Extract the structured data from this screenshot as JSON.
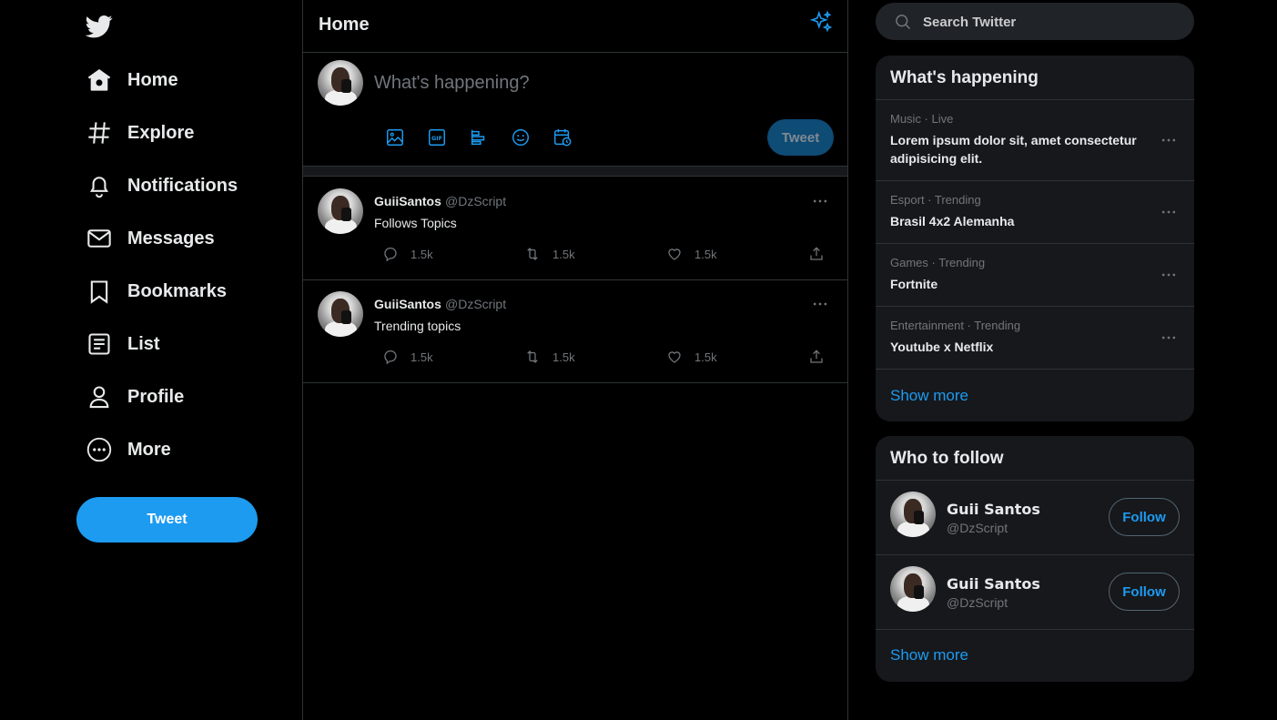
{
  "colors": {
    "accent": "#1d9bf0",
    "background": "#000000",
    "panel": "#16181c",
    "muted": "#71767b"
  },
  "nav": {
    "items": [
      {
        "icon": "home-icon",
        "label": "Home"
      },
      {
        "icon": "hashtag-icon",
        "label": "Explore"
      },
      {
        "icon": "bell-icon",
        "label": "Notifications"
      },
      {
        "icon": "mail-icon",
        "label": "Messages"
      },
      {
        "icon": "bookmark-icon",
        "label": "Bookmarks"
      },
      {
        "icon": "list-icon",
        "label": "List"
      },
      {
        "icon": "person-icon",
        "label": "Profile"
      },
      {
        "icon": "more-circle-icon",
        "label": "More"
      }
    ],
    "tweet_button": "Tweet"
  },
  "main": {
    "title": "Home",
    "composer": {
      "placeholder": "What's happening?",
      "tweet_button": "Tweet"
    },
    "tweets": [
      {
        "name": "GuiiSantos",
        "handle": "@DzScript",
        "text": "Follows Topics",
        "replies": "1.5k",
        "retweets": "1.5k",
        "likes": "1.5k"
      },
      {
        "name": "GuiiSantos",
        "handle": "@DzScript",
        "text": "Trending topics",
        "replies": "1.5k",
        "retweets": "1.5k",
        "likes": "1.5k"
      }
    ]
  },
  "right": {
    "search_placeholder": "Search Twitter",
    "happening": {
      "title": "What's happening",
      "trends": [
        {
          "meta": "Music · Live",
          "topic": "Lorem ipsum dolor sit, amet consectetur adipisicing elit."
        },
        {
          "meta": "Esport · Trending",
          "topic": "Brasil 4x2 Alemanha"
        },
        {
          "meta": "Games · Trending",
          "topic": "Fortnite"
        },
        {
          "meta": "Entertainment · Trending",
          "topic": "Youtube x Netflix"
        }
      ],
      "show_more": "Show more"
    },
    "who_to_follow": {
      "title": "Who to follow",
      "users": [
        {
          "name": "Guii Santos",
          "handle": "@DzScript",
          "button": "Follow"
        },
        {
          "name": "Guii Santos",
          "handle": "@DzScript",
          "button": "Follow"
        }
      ],
      "show_more": "Show more"
    }
  }
}
